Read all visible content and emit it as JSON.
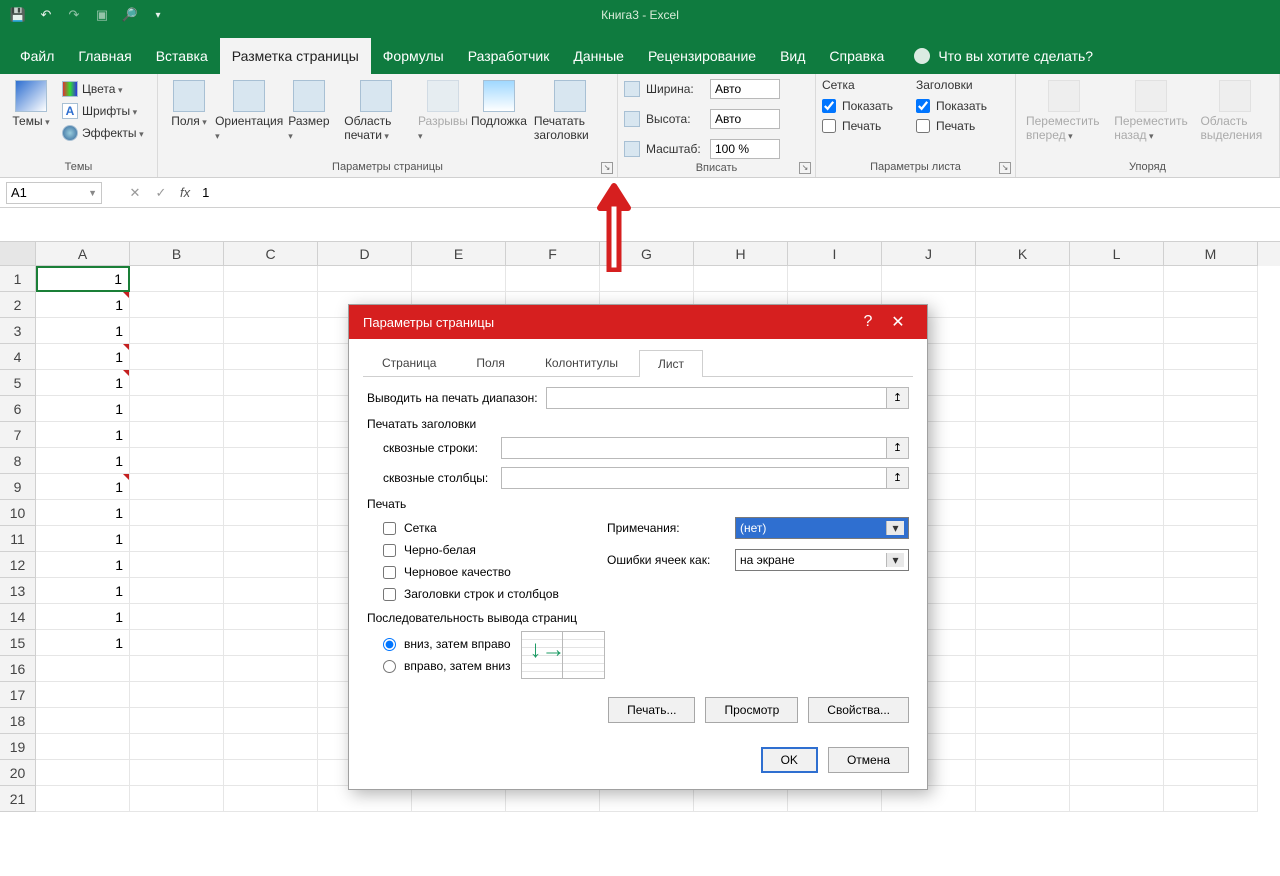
{
  "app": {
    "title": "Книга3  -  Excel"
  },
  "qat": [
    "save-icon",
    "undo-icon",
    "redo-icon",
    "camera-icon",
    "print-preview-icon"
  ],
  "tabs": {
    "file": "Файл",
    "home": "Главная",
    "insert": "Вставка",
    "pagelayout": "Разметка страницы",
    "formulas": "Формулы",
    "developer": "Разработчик",
    "data": "Данные",
    "review": "Рецензирование",
    "view": "Вид",
    "help": "Справка",
    "tellme": "Что вы хотите сделать?"
  },
  "ribbon": {
    "themes": {
      "label": "Темы",
      "themes": "Темы",
      "colors": "Цвета",
      "fonts": "Шрифты",
      "effects": "Эффекты"
    },
    "pagesetup": {
      "label": "Параметры страницы",
      "margins": "Поля",
      "orientation": "Ориентация",
      "size": "Размер",
      "printarea": "Область печати",
      "breaks": "Разрывы",
      "background": "Подложка",
      "printtitles": "Печатать заголовки"
    },
    "fit": {
      "label": "Вписать",
      "width": "Ширина:",
      "height": "Высота:",
      "scale": "Масштаб:",
      "width_val": "Авто",
      "height_val": "Авто",
      "scale_val": "100 %"
    },
    "sheetopt": {
      "label": "Параметры листа",
      "grid": "Сетка",
      "headings": "Заголовки",
      "show": "Показать",
      "print": "Печать"
    },
    "arrange": {
      "label": "Упоряд",
      "forward": "Переместить вперед",
      "backward": "Переместить назад",
      "selpane": "Область выделения"
    }
  },
  "fbar": {
    "name": "A1",
    "value": "1"
  },
  "columns": [
    "A",
    "B",
    "C",
    "D",
    "E",
    "F",
    "G",
    "H",
    "I",
    "J",
    "K",
    "L",
    "M"
  ],
  "rows": [
    1,
    2,
    3,
    4,
    5,
    6,
    7,
    8,
    9,
    10,
    11,
    12,
    13,
    14,
    15,
    16,
    17,
    18,
    19,
    20,
    21
  ],
  "cellsA": [
    "1",
    "1",
    "1",
    "1",
    "1",
    "1",
    "1",
    "1",
    "1",
    "1",
    "1",
    "1",
    "1",
    "1",
    "1"
  ],
  "redmarks": [
    2,
    4,
    5,
    9
  ],
  "dialog": {
    "title": "Параметры страницы",
    "tabs": {
      "page": "Страница",
      "margins": "Поля",
      "header": "Колонтитулы",
      "sheet": "Лист"
    },
    "range_label": "Выводить на печать диапазон:",
    "titles_section": "Печатать заголовки",
    "rows_label": "сквозные строки:",
    "cols_label": "сквозные столбцы:",
    "print_section": "Печать",
    "chk_grid": "Сетка",
    "chk_bw": "Черно-белая",
    "chk_draft": "Черновое качество",
    "chk_rc": "Заголовки строк и столбцов",
    "comments_label": "Примечания:",
    "comments_val": "(нет)",
    "errors_label": "Ошибки ячеек как:",
    "errors_val": "на экране",
    "order_section": "Последовательность вывода страниц",
    "order_down": "вниз, затем вправо",
    "order_over": "вправо, затем вниз",
    "btn_print": "Печать...",
    "btn_preview": "Просмотр",
    "btn_props": "Свойства...",
    "ok": "OK",
    "cancel": "Отмена"
  }
}
